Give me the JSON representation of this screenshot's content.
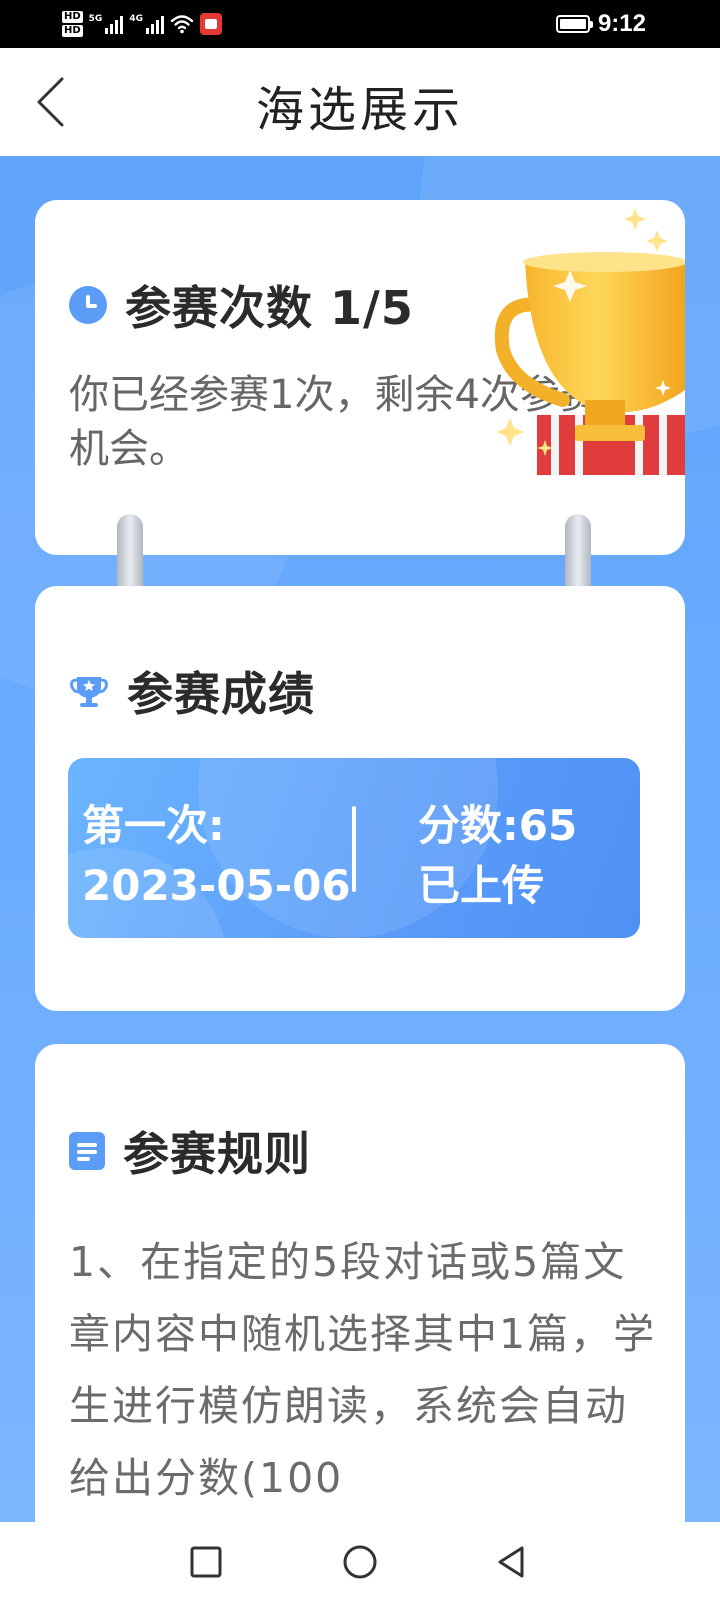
{
  "status_bar": {
    "hd_top": "HD",
    "hd_bottom": "HD",
    "signal_1_tag": "5G",
    "signal_2_tag": "4G",
    "time": "9:12",
    "notification_color": "#e53935"
  },
  "header": {
    "back_icon": "chevron-left-icon",
    "title": "海选展示"
  },
  "attempts_card": {
    "icon": "clock-icon",
    "heading": "参赛次数 1/5",
    "description": "你已经参赛1次，剩余4次参赛机会。",
    "used": 1,
    "total": 5,
    "art": "trophy-illustration"
  },
  "results_card": {
    "icon": "trophy-icon",
    "heading": "参赛成绩",
    "entries": [
      {
        "attempt_label": "第一次:",
        "date": "2023-05-06",
        "score_label": "分数:65",
        "status": "已上传"
      }
    ]
  },
  "rules_card": {
    "icon": "document-icon",
    "heading": "参赛规则",
    "text": "1、在指定的5段对话或5篇文章内容中随机选择其中1篇，学生进行模仿朗读，系统会自动给出分数(100"
  },
  "nav_bar": {
    "recents_icon": "square-icon",
    "home_icon": "circle-icon",
    "back_icon": "triangle-back-icon"
  },
  "colors": {
    "accent": "#5b9cf6",
    "background_blue": "#6aabff",
    "heading_text": "#2b2b2b",
    "body_text": "#666666"
  }
}
